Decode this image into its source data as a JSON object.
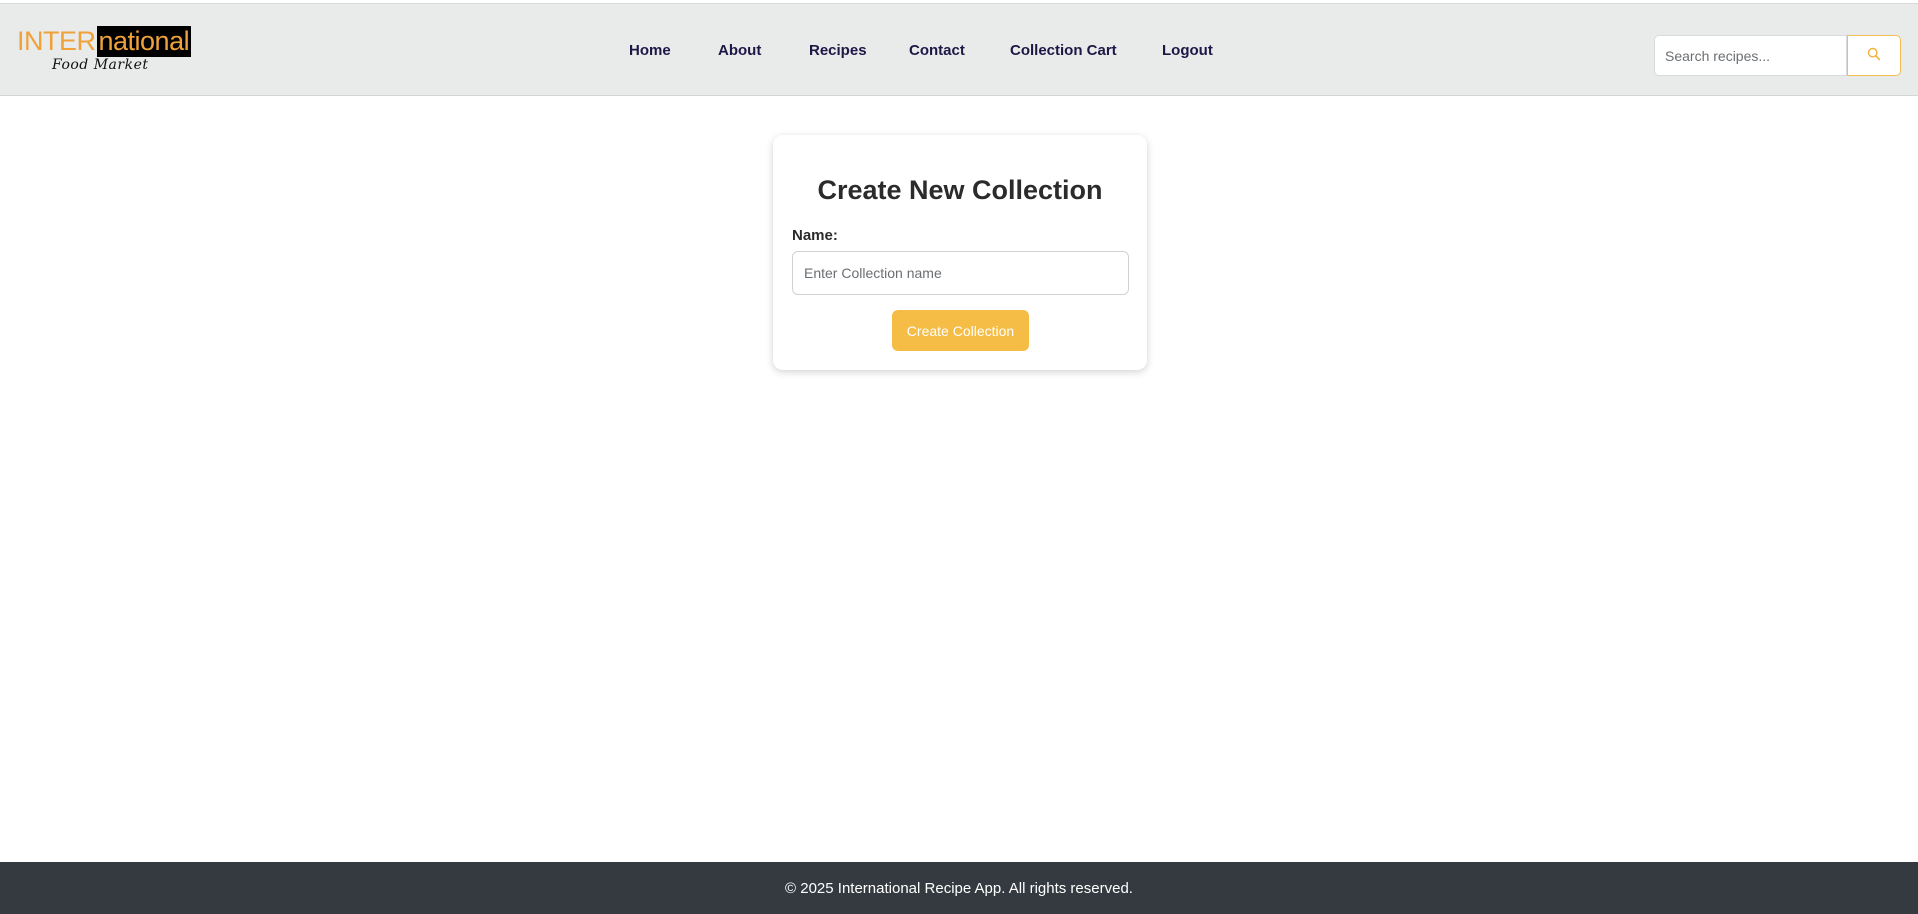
{
  "logo": {
    "part1": "INTER",
    "part2": "national",
    "subtitle": "Food Market"
  },
  "nav": {
    "items": [
      {
        "label": "Home"
      },
      {
        "label": "About"
      },
      {
        "label": "Recipes"
      },
      {
        "label": "Contact"
      },
      {
        "label": "Collection Cart"
      },
      {
        "label": "Logout"
      }
    ]
  },
  "search": {
    "placeholder": "Search recipes...",
    "icon": "search-icon"
  },
  "form": {
    "title": "Create New Collection",
    "name_label": "Name:",
    "name_placeholder": "Enter Collection name",
    "name_value": "",
    "submit_label": "Create Collection"
  },
  "footer": {
    "text": "© 2025 International Recipe App. All rights reserved."
  },
  "colors": {
    "accent": "#f5bd45",
    "navbar_bg": "#e9eaea",
    "footer_bg": "#343a40",
    "nav_text": "#1e1746"
  }
}
